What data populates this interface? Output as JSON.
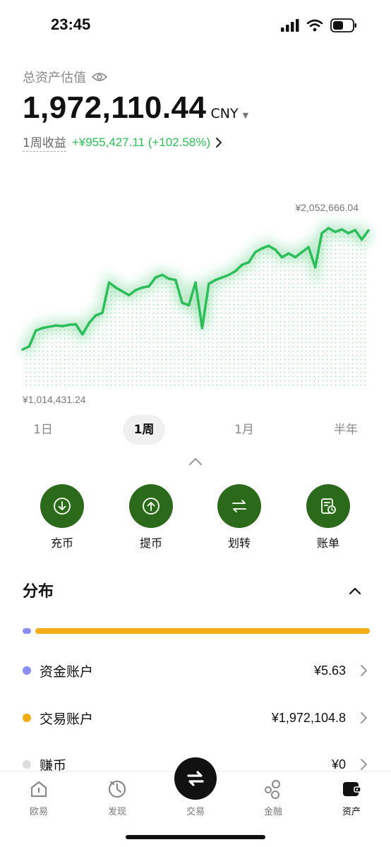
{
  "status_bar": {
    "time": "23:45",
    "icons": [
      "cellular-signal-icon",
      "wifi-icon",
      "battery-icon"
    ]
  },
  "header": {
    "asset_label": "总资产估值",
    "total_value": "1,972,110.44",
    "currency": "CNY",
    "pnl_label": "1周收益",
    "pnl_value": "+¥955,427.11 (+102.58%)"
  },
  "chart_data": {
    "type": "line",
    "title": "",
    "max_label": "¥2,052,666.04",
    "min_label": "¥1,014,431.24",
    "ylim": [
      1014431.24,
      2052666.04
    ],
    "series": [
      {
        "color": "#2dbd5a",
        "values": [
          1030000,
          1055000,
          1180000,
          1200000,
          1210000,
          1220000,
          1215000,
          1225000,
          1230000,
          1150000,
          1240000,
          1300000,
          1320000,
          1560000,
          1520000,
          1490000,
          1460000,
          1500000,
          1520000,
          1530000,
          1600000,
          1620000,
          1590000,
          1580000,
          1400000,
          1380000,
          1560000,
          1200000,
          1550000,
          1580000,
          1600000,
          1620000,
          1650000,
          1700000,
          1720000,
          1800000,
          1830000,
          1850000,
          1820000,
          1760000,
          1790000,
          1760000,
          1800000,
          1840000,
          1680000,
          1950000,
          1990000,
          1960000,
          1980000,
          1950000,
          1975000,
          1900000,
          1972110
        ]
      }
    ]
  },
  "range_tabs": [
    {
      "label": "1日",
      "active": false
    },
    {
      "label": "1周",
      "active": true
    },
    {
      "label": "1月",
      "active": false
    },
    {
      "label": "半年",
      "active": false
    }
  ],
  "quick_actions": [
    {
      "label": "充币",
      "icon": "deposit-icon"
    },
    {
      "label": "提币",
      "icon": "withdraw-icon"
    },
    {
      "label": "划转",
      "icon": "transfer-icon"
    },
    {
      "label": "账单",
      "icon": "bill-icon"
    }
  ],
  "distribution": {
    "title": "分布",
    "accounts": [
      {
        "name": "资金账户",
        "value": "¥5.63",
        "color": "#8b8ef5"
      },
      {
        "name": "交易账户",
        "value": "¥1,972,104.8",
        "color": "#f2ad16"
      },
      {
        "name": "赚币",
        "value": "¥0",
        "color": "#dddddd"
      }
    ]
  },
  "bottom_nav": [
    {
      "label": "欧易",
      "icon": "home-icon",
      "active": false
    },
    {
      "label": "发现",
      "icon": "discover-icon",
      "active": false
    },
    {
      "label": "交易",
      "icon": "trade-icon",
      "active": false
    },
    {
      "label": "金融",
      "icon": "finance-icon",
      "active": false
    },
    {
      "label": "资产",
      "icon": "wallet-icon",
      "active": true
    }
  ],
  "colors": {
    "accent_green": "#2dbd5a",
    "action_green": "#2a6a1a"
  }
}
